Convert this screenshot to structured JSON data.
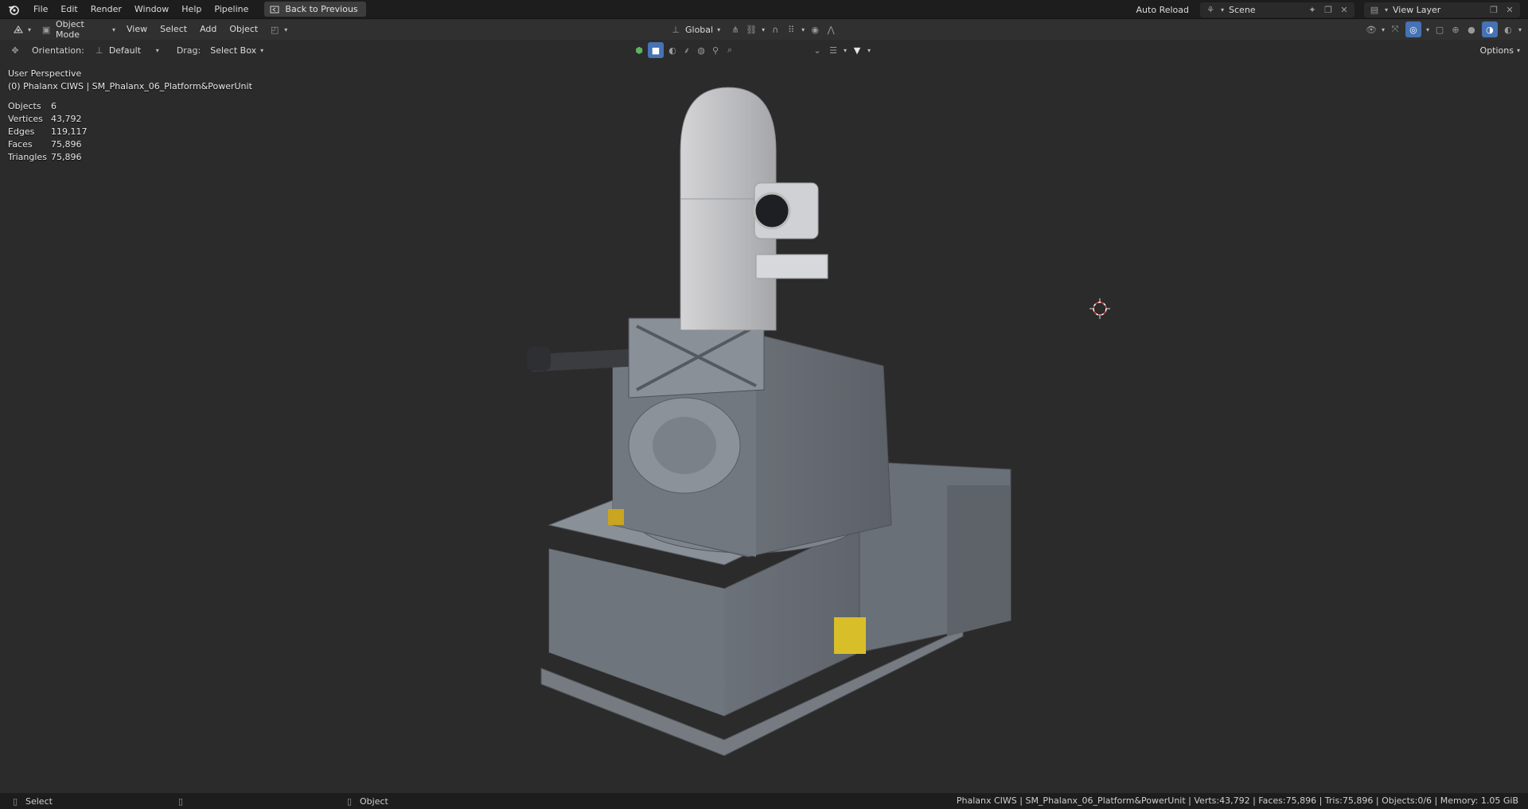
{
  "topbar": {
    "menus": [
      "File",
      "Edit",
      "Render",
      "Window",
      "Help",
      "Pipeline"
    ],
    "back_button": "Back to Previous",
    "auto_reload": "Auto Reload",
    "scene": "Scene",
    "view_layer": "View Layer"
  },
  "header": {
    "mode": "Object Mode",
    "menus": [
      "View",
      "Select",
      "Add",
      "Object"
    ],
    "transform_orientation": "Global"
  },
  "tool_settings": {
    "orientation_label": "Orientation:",
    "orientation_value": "Default",
    "drag_label": "Drag:",
    "drag_value": "Select Box",
    "options": "Options"
  },
  "viewport": {
    "perspective": "User Perspective",
    "active_object": "(0) Phalanx CIWS | SM_Phalanx_06_Platform&PowerUnit"
  },
  "stats": [
    {
      "label": "Objects",
      "value": "6"
    },
    {
      "label": "Vertices",
      "value": "43,792"
    },
    {
      "label": "Edges",
      "value": "119,117"
    },
    {
      "label": "Faces",
      "value": "75,896"
    },
    {
      "label": "Triangles",
      "value": "75,896"
    }
  ],
  "statusbar": {
    "left_action": "Select",
    "right_action": "Object",
    "info": "Phalanx CIWS | SM_Phalanx_06_Platform&PowerUnit | Verts:43,792 | Faces:75,896 | Tris:75,896 | Objects:0/6 | Memory: 1.05 GiB"
  },
  "colors": {
    "accent": "#4772b3",
    "topbar_bg": "#1d1d1d",
    "header_bg": "#303030"
  }
}
